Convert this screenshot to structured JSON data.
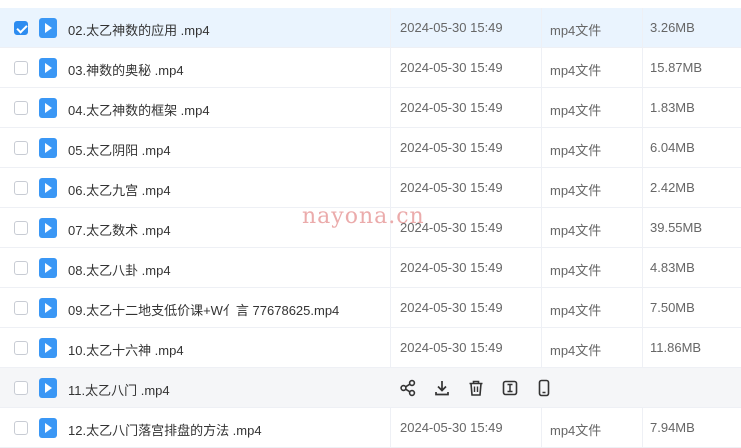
{
  "colors": {
    "accent": "#2d8cf0",
    "file_icon": "#3a97f5",
    "watermark": "#e9a2a2"
  },
  "files": [
    {
      "name": "02.太乙神数的应用 .mp4",
      "date": "2024-05-30 15:49",
      "type": "mp4文件",
      "size": "3.26MB",
      "checked": true
    },
    {
      "name": "03.神数的奥秘 .mp4",
      "date": "2024-05-30 15:49",
      "type": "mp4文件",
      "size": "15.87MB"
    },
    {
      "name": "04.太乙神数的框架 .mp4",
      "date": "2024-05-30 15:49",
      "type": "mp4文件",
      "size": "1.83MB"
    },
    {
      "name": "05.太乙阴阳 .mp4",
      "date": "2024-05-30 15:49",
      "type": "mp4文件",
      "size": "6.04MB"
    },
    {
      "name": "06.太乙九宫 .mp4",
      "date": "2024-05-30 15:49",
      "type": "mp4文件",
      "size": "2.42MB"
    },
    {
      "name": "07.太乙数术 .mp4",
      "date": "2024-05-30 15:49",
      "type": "mp4文件",
      "size": "39.55MB"
    },
    {
      "name": "08.太乙八卦 .mp4",
      "date": "2024-05-30 15:49",
      "type": "mp4文件",
      "size": "4.83MB"
    },
    {
      "name": "09.太乙十二地支低价课+W亻言 77678625.mp4",
      "date": "2024-05-30 15:49",
      "type": "mp4文件",
      "size": "7.50MB"
    },
    {
      "name": "10.太乙十六神 .mp4",
      "date": "2024-05-30 15:49",
      "type": "mp4文件",
      "size": "11.86MB"
    },
    {
      "name": "11.太乙八门 .mp4",
      "hover": true,
      "actions": [
        "share-icon",
        "download-icon",
        "delete-icon",
        "rename-icon",
        "mobile-icon"
      ]
    },
    {
      "name": "12.太乙八门落宫排盘的方法 .mp4",
      "date": "2024-05-30 15:49",
      "type": "mp4文件",
      "size": "7.94MB"
    }
  ],
  "watermark": "nayona.cn"
}
